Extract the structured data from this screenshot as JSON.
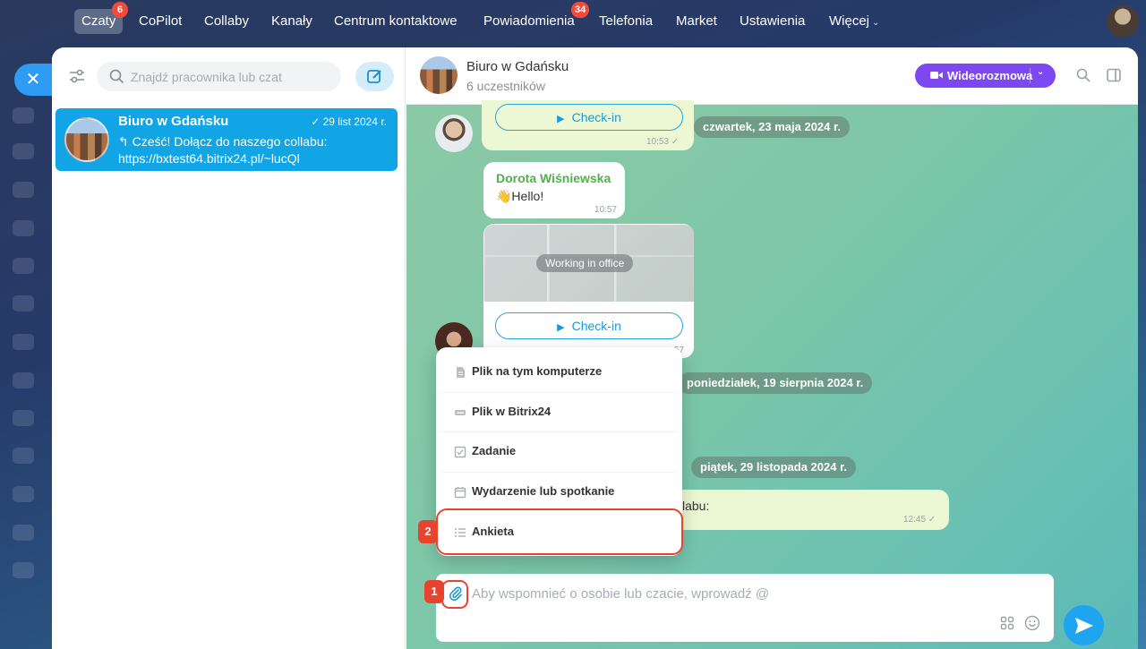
{
  "nav": {
    "items": [
      {
        "label": "Czaty",
        "badge": "6",
        "active": true
      },
      {
        "label": "CoPilot"
      },
      {
        "label": "Collaby"
      },
      {
        "label": "Kanały"
      },
      {
        "label": "Centrum kontaktowe"
      },
      {
        "label": "Powiadomienia",
        "badge": "34"
      },
      {
        "label": "Telefonia"
      },
      {
        "label": "Market"
      },
      {
        "label": "Ustawienia"
      },
      {
        "label": "Więcej"
      }
    ]
  },
  "sidebar": {
    "search_placeholder": "Znajdź pracownika lub czat",
    "chat_item": {
      "title": "Biuro w Gdańsku",
      "date": "✓ 29 list 2024 r.",
      "preview": "↰ Cześć! Dołącz do naszego collabu: https://bxtest64.bitrix24.pl/~lucQl"
    }
  },
  "chat": {
    "title": "Biuro w Gdańsku",
    "subtitle": "6 uczestników",
    "video_button": "Wideorozmowa",
    "messages": {
      "checkin_1": "Check-in",
      "checkin_1_time": "10:53 ✓",
      "date_1": "czwartek, 23 maja 2024 r.",
      "author": "Dorota Wiśniewska",
      "hello": "👋Hello!",
      "hello_time": "10:57",
      "map_label": "Working in office",
      "checkin_2": "Check-in",
      "checkin_2_time": "57",
      "date_2": "poniedziałek, 19 sierpnia 2024 r.",
      "date_3": "piątek, 29 listopada 2024 r.",
      "collab_fragment": "labu:",
      "collab_time": "12:45 ✓"
    },
    "input_placeholder": "Aby wspomnieć o osobie lub czacie, wprowadź @"
  },
  "menu": {
    "items": [
      {
        "label": "Plik na tym komputerze",
        "icon": "file-icon"
      },
      {
        "label": "Plik w Bitrix24",
        "icon": "drive-icon"
      },
      {
        "label": "Zadanie",
        "icon": "task-icon"
      },
      {
        "label": "Wydarzenie lub spotkanie",
        "icon": "calendar-icon"
      },
      {
        "label": "Ankieta",
        "icon": "poll-icon"
      }
    ]
  },
  "markers": {
    "one": "1",
    "two": "2"
  },
  "colors": {
    "accent": "#12a5e6",
    "video": "#7d47f2",
    "highlight": "#e8432f",
    "badge": "#f24b3c"
  }
}
